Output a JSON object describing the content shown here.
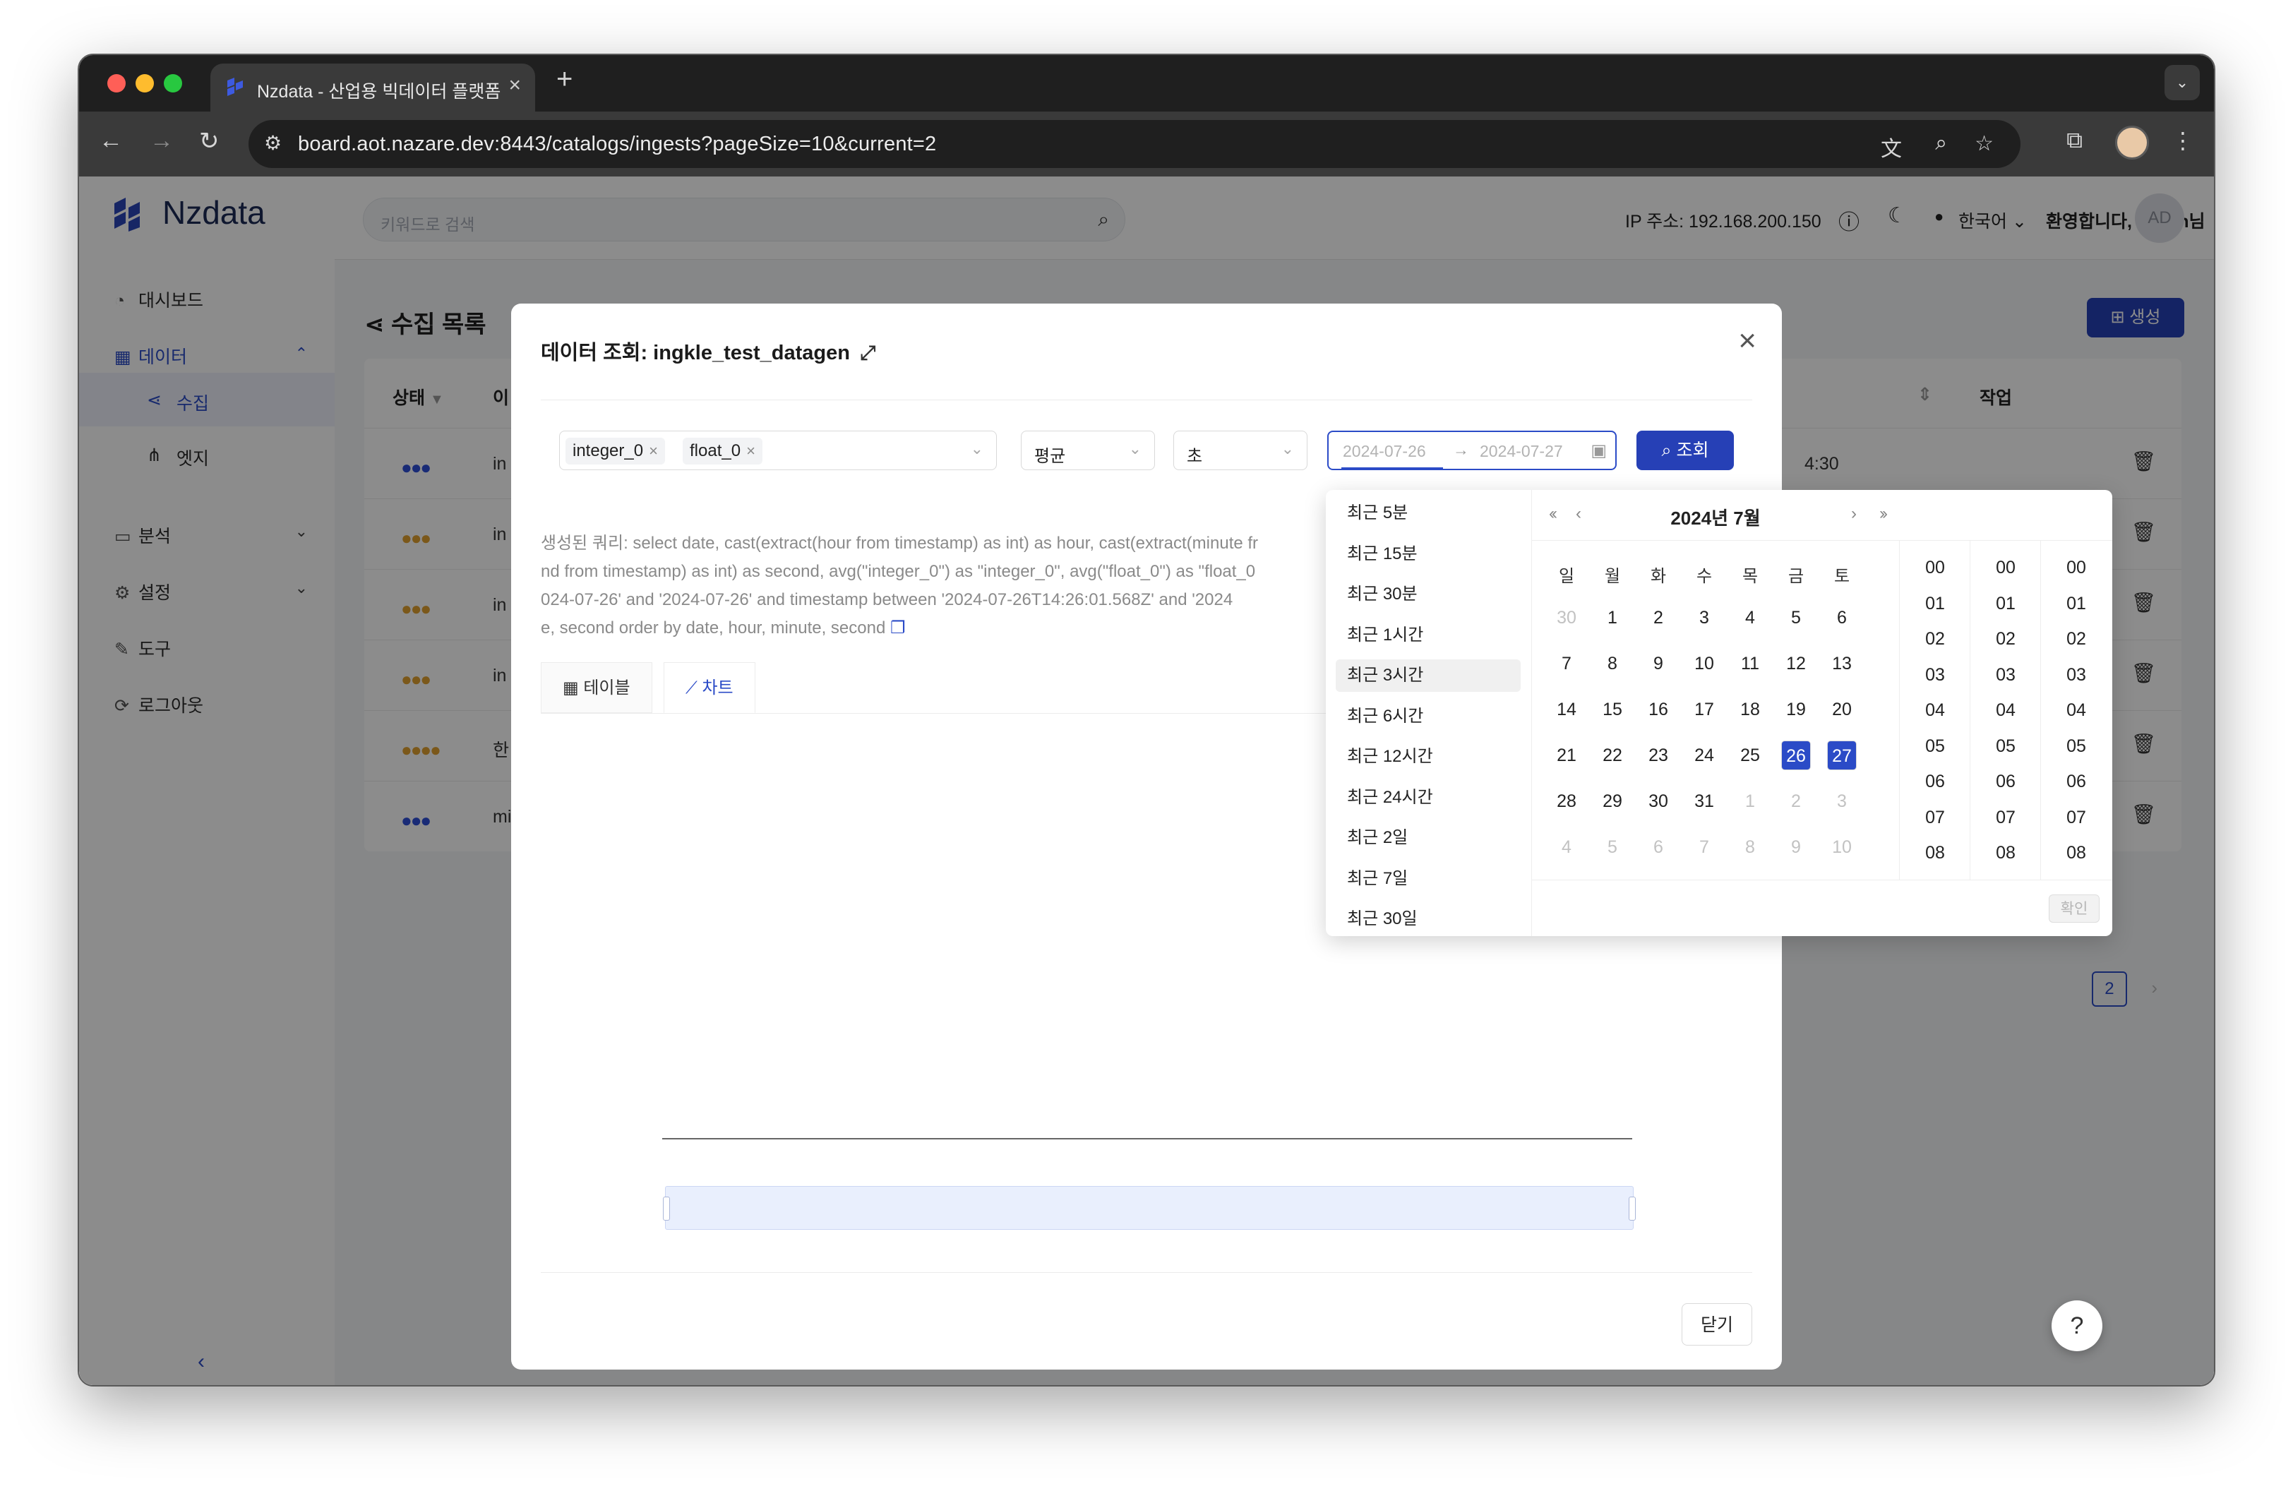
{
  "browser": {
    "tab_title": "Nzdata - 산업용 빅데이터 플랫폼",
    "url": "board.aot.nazare.dev:8443/catalogs/ingests?pageSize=10&current=2"
  },
  "app": {
    "logo": "Nzdata",
    "search_placeholder": "키워드로 검색",
    "ip_label": "IP 주소: 192.168.200.150",
    "language": "한국어",
    "welcome": "환영합니다, admin님",
    "avatar": "AD"
  },
  "sidebar": {
    "dashboard": "대시보드",
    "data": "데이터",
    "ingest": "수집",
    "edge": "엣지",
    "analysis": "분석",
    "settings": "설정",
    "tools": "도구",
    "logout": "로그아웃"
  },
  "page": {
    "title": "수집 목록",
    "create": "생성",
    "col_status": "상태",
    "col_name": "이",
    "col_action": "작업",
    "row_time": "4:30",
    "row_names": [
      "in",
      "in",
      "in",
      "in",
      "한",
      "mi"
    ],
    "row_dot_colors": [
      "#2f4fd8",
      "#e0a030",
      "#e0a030",
      "#e0a030",
      "#e0a030",
      "#2f4fd8"
    ],
    "page_number": "2"
  },
  "modal": {
    "title": "데이터 조회: ingkle_test_datagen",
    "tags": [
      "integer_0",
      "float_0"
    ],
    "aggregate": "평균",
    "unit": "초",
    "range_start": "2024-07-26",
    "range_end": "2024-07-27",
    "query_button": "조회",
    "query_lines": [
      "생성된 쿼리: select date, cast(extract(hour from timestamp) as int) as hour, cast(extract(minute fr",
      "nd from timestamp) as int) as second, avg(\"integer_0\") as \"integer_0\", avg(\"float_0\") as \"float_0",
      "024-07-26' and '2024-07-26' and timestamp between '2024-07-26T14:26:01.568Z' and '2024",
      "e, second order by date, hour, minute, second"
    ],
    "tab_table": "테이블",
    "tab_chart": "차트",
    "close_button": "닫기"
  },
  "picker": {
    "presets": [
      "최근 5분",
      "최근 15분",
      "최근 30분",
      "최근 1시간",
      "최근 3시간",
      "최근 6시간",
      "최근 12시간",
      "최근 24시간",
      "최근 2일",
      "최근 7일",
      "최근 30일"
    ],
    "highlighted_preset": 4,
    "month_label": "2024년 7월",
    "weekdays": [
      "일",
      "월",
      "화",
      "수",
      "목",
      "금",
      "토"
    ],
    "weeks": [
      [
        {
          "d": "30",
          "dim": true
        },
        {
          "d": "1"
        },
        {
          "d": "2"
        },
        {
          "d": "3"
        },
        {
          "d": "4"
        },
        {
          "d": "5"
        },
        {
          "d": "6"
        }
      ],
      [
        {
          "d": "7"
        },
        {
          "d": "8"
        },
        {
          "d": "9"
        },
        {
          "d": "10"
        },
        {
          "d": "11"
        },
        {
          "d": "12"
        },
        {
          "d": "13"
        }
      ],
      [
        {
          "d": "14"
        },
        {
          "d": "15"
        },
        {
          "d": "16"
        },
        {
          "d": "17"
        },
        {
          "d": "18"
        },
        {
          "d": "19"
        },
        {
          "d": "20"
        }
      ],
      [
        {
          "d": "21"
        },
        {
          "d": "22"
        },
        {
          "d": "23"
        },
        {
          "d": "24"
        },
        {
          "d": "25"
        },
        {
          "d": "26",
          "sel": true
        },
        {
          "d": "27",
          "sel": true
        }
      ],
      [
        {
          "d": "28"
        },
        {
          "d": "29"
        },
        {
          "d": "30"
        },
        {
          "d": "31"
        },
        {
          "d": "1",
          "dim": true
        },
        {
          "d": "2",
          "dim": true
        },
        {
          "d": "3",
          "dim": true
        }
      ],
      [
        {
          "d": "4",
          "dim": true
        },
        {
          "d": "5",
          "dim": true
        },
        {
          "d": "6",
          "dim": true
        },
        {
          "d": "7",
          "dim": true
        },
        {
          "d": "8",
          "dim": true
        },
        {
          "d": "9",
          "dim": true
        },
        {
          "d": "10",
          "dim": true
        }
      ]
    ],
    "hours": [
      "00",
      "01",
      "02",
      "03",
      "04",
      "05",
      "06",
      "07",
      "08"
    ],
    "minutes": [
      "00",
      "01",
      "02",
      "03",
      "04",
      "05",
      "06",
      "07",
      "08"
    ],
    "seconds": [
      "00",
      "01",
      "02",
      "03",
      "04",
      "05",
      "06",
      "07",
      "08"
    ],
    "ok_button": "확인"
  },
  "colors": {
    "accent": "#2640b6",
    "selected_day": "#2b4bc7"
  }
}
